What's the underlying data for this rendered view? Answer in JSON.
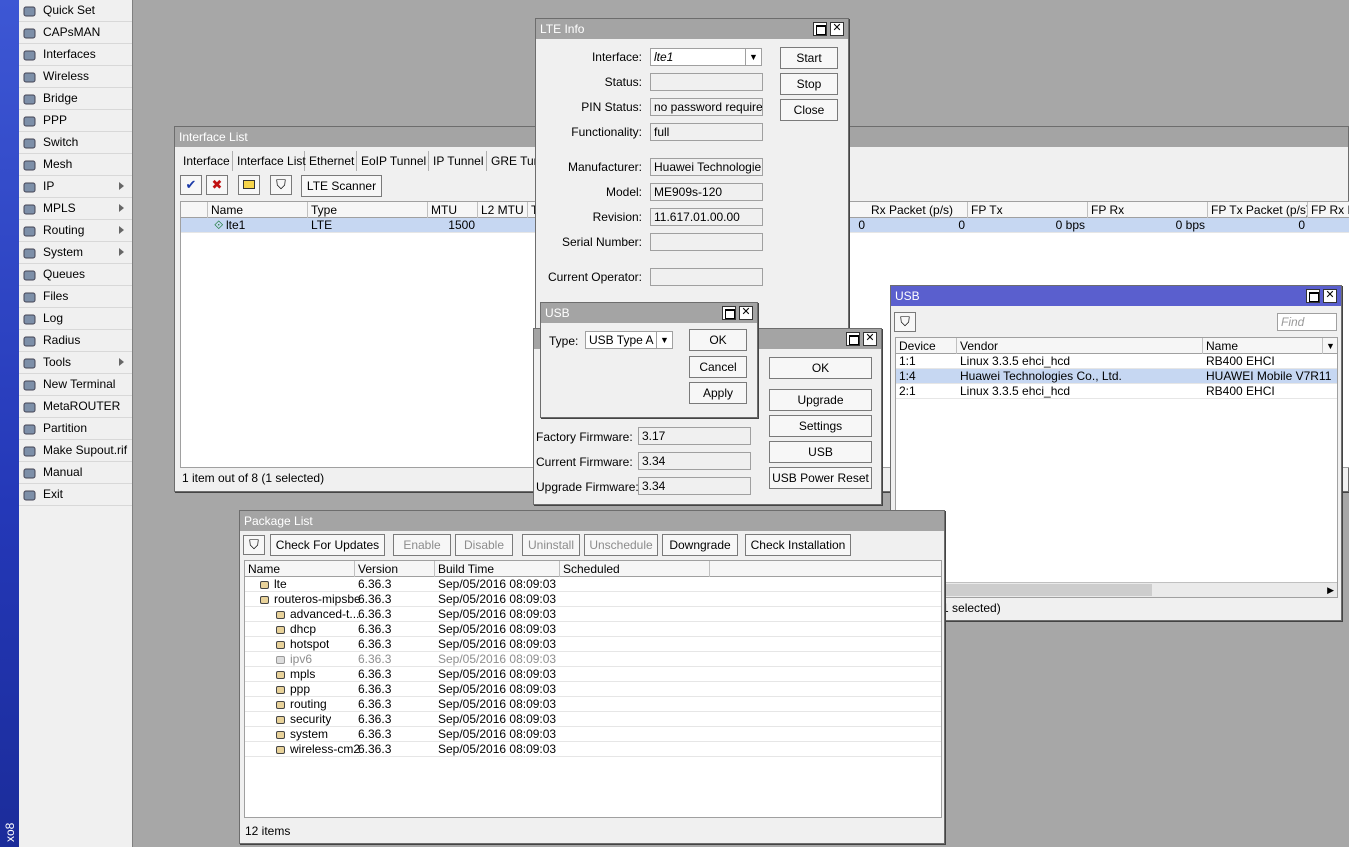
{
  "app": {
    "sidebar_label": "xo8"
  },
  "menu": [
    {
      "label": "Quick Set",
      "icon": "quick-set-icon",
      "submenu": false
    },
    {
      "label": "CAPsMAN",
      "icon": "capsman-icon",
      "submenu": false
    },
    {
      "label": "Interfaces",
      "icon": "interfaces-icon",
      "submenu": false
    },
    {
      "label": "Wireless",
      "icon": "wireless-icon",
      "submenu": false
    },
    {
      "label": "Bridge",
      "icon": "bridge-icon",
      "submenu": false
    },
    {
      "label": "PPP",
      "icon": "ppp-icon",
      "submenu": false
    },
    {
      "label": "Switch",
      "icon": "switch-icon",
      "submenu": false
    },
    {
      "label": "Mesh",
      "icon": "mesh-icon",
      "submenu": false
    },
    {
      "label": "IP",
      "icon": "ip-icon",
      "submenu": true
    },
    {
      "label": "MPLS",
      "icon": "mpls-icon",
      "submenu": true
    },
    {
      "label": "Routing",
      "icon": "routing-icon",
      "submenu": true
    },
    {
      "label": "System",
      "icon": "system-icon",
      "submenu": true
    },
    {
      "label": "Queues",
      "icon": "queues-icon",
      "submenu": false
    },
    {
      "label": "Files",
      "icon": "files-icon",
      "submenu": false
    },
    {
      "label": "Log",
      "icon": "log-icon",
      "submenu": false
    },
    {
      "label": "Radius",
      "icon": "radius-icon",
      "submenu": false
    },
    {
      "label": "Tools",
      "icon": "tools-icon",
      "submenu": true
    },
    {
      "label": "New Terminal",
      "icon": "terminal-icon",
      "submenu": false
    },
    {
      "label": "MetaROUTER",
      "icon": "metarouter-icon",
      "submenu": false
    },
    {
      "label": "Partition",
      "icon": "partition-icon",
      "submenu": false
    },
    {
      "label": "Make Supout.rif",
      "icon": "supout-icon",
      "submenu": false
    },
    {
      "label": "Manual",
      "icon": "manual-icon",
      "submenu": false
    },
    {
      "label": "Exit",
      "icon": "exit-icon",
      "submenu": false
    }
  ],
  "interface_list": {
    "title": "Interface List",
    "tabs": [
      "Interface",
      "Interface List",
      "Ethernet",
      "EoIP Tunnel",
      "IP Tunnel",
      "GRE Tun"
    ],
    "lte_scanner": "LTE Scanner",
    "columns": [
      "Name",
      "Type",
      "MTU",
      "L2 MTU",
      "T",
      "Rx Packet (p/s)",
      "FP Tx",
      "FP Rx",
      "FP Tx Packet (p/s)",
      "FP Rx P"
    ],
    "row": {
      "name": "lte1",
      "type": "LTE",
      "mtu": "1500",
      "tx_packet": "0",
      "rx_packet": "0",
      "fp_tx": "0 bps",
      "fp_rx": "0 bps",
      "fp_tx_packet": "0"
    },
    "status": "1 item out of 8 (1 selected)"
  },
  "lte_info": {
    "title": "LTE Info",
    "fields": {
      "interface_label": "Interface:",
      "interface_value": "lte1",
      "status_label": "Status:",
      "status_value": "",
      "pin_label": "PIN Status:",
      "pin_value": "no password required",
      "func_label": "Functionality:",
      "func_value": "full",
      "manuf_label": "Manufacturer:",
      "manuf_value": "Huawei Technologie...",
      "model_label": "Model:",
      "model_value": "ME909s-120",
      "rev_label": "Revision:",
      "rev_value": "11.617.01.00.00",
      "serial_label": "Serial Number:",
      "serial_value": "",
      "operator_label": "Current Operator:",
      "operator_value": ""
    },
    "buttons": {
      "start": "Start",
      "stop": "Stop",
      "close": "Close"
    }
  },
  "firmware": {
    "factory_label": "Factory Firmware:",
    "factory_value": "3.17",
    "current_label": "Current Firmware:",
    "current_value": "3.34",
    "upgrade_label": "Upgrade Firmware:",
    "upgrade_value": "3.34",
    "buttons": {
      "ok": "OK",
      "upgrade": "Upgrade",
      "settings": "Settings",
      "usb": "USB",
      "usb_power_reset": "USB Power Reset"
    }
  },
  "usb_dialog": {
    "title": "USB",
    "type_label": "Type:",
    "type_value": "USB Type A",
    "buttons": {
      "ok": "OK",
      "cancel": "Cancel",
      "apply": "Apply"
    }
  },
  "usb_window": {
    "title": "USB",
    "find_placeholder": "Find",
    "columns": [
      "Device",
      "Vendor",
      "Name"
    ],
    "rows": [
      {
        "device": "1:1",
        "vendor": "Linux 3.3.5 ehci_hcd",
        "name": "RB400 EHCI",
        "selected": false
      },
      {
        "device": "1:4",
        "vendor": "Huawei Technologies Co., Ltd.",
        "name": "HUAWEI Mobile V7R11",
        "selected": true
      },
      {
        "device": "2:1",
        "vendor": "Linux 3.3.5 ehci_hcd",
        "name": "RB400 EHCI",
        "selected": false
      }
    ],
    "status": "3 items (1 selected)"
  },
  "package_list": {
    "title": "Package List",
    "buttons": {
      "check_updates": "Check For Updates",
      "enable": "Enable",
      "disable": "Disable",
      "uninstall": "Uninstall",
      "unschedule": "Unschedule",
      "downgrade": "Downgrade",
      "check_installation": "Check Installation"
    },
    "columns": [
      "Name",
      "Version",
      "Build Time",
      "Scheduled"
    ],
    "rows": [
      {
        "name": "lte",
        "version": "6.36.3",
        "build": "Sep/05/2016 08:09:03",
        "indent": 0,
        "disabled": false
      },
      {
        "name": "routeros-mipsbe",
        "version": "6.36.3",
        "build": "Sep/05/2016 08:09:03",
        "indent": 0,
        "disabled": false
      },
      {
        "name": "advanced-t...",
        "version": "6.36.3",
        "build": "Sep/05/2016 08:09:03",
        "indent": 1,
        "disabled": false
      },
      {
        "name": "dhcp",
        "version": "6.36.3",
        "build": "Sep/05/2016 08:09:03",
        "indent": 1,
        "disabled": false
      },
      {
        "name": "hotspot",
        "version": "6.36.3",
        "build": "Sep/05/2016 08:09:03",
        "indent": 1,
        "disabled": false
      },
      {
        "name": "ipv6",
        "version": "6.36.3",
        "build": "Sep/05/2016 08:09:03",
        "indent": 1,
        "disabled": true
      },
      {
        "name": "mpls",
        "version": "6.36.3",
        "build": "Sep/05/2016 08:09:03",
        "indent": 1,
        "disabled": false
      },
      {
        "name": "ppp",
        "version": "6.36.3",
        "build": "Sep/05/2016 08:09:03",
        "indent": 1,
        "disabled": false
      },
      {
        "name": "routing",
        "version": "6.36.3",
        "build": "Sep/05/2016 08:09:03",
        "indent": 1,
        "disabled": false
      },
      {
        "name": "security",
        "version": "6.36.3",
        "build": "Sep/05/2016 08:09:03",
        "indent": 1,
        "disabled": false
      },
      {
        "name": "system",
        "version": "6.36.3",
        "build": "Sep/05/2016 08:09:03",
        "indent": 1,
        "disabled": false
      },
      {
        "name": "wireless-cm2",
        "version": "6.36.3",
        "build": "Sep/05/2016 08:09:03",
        "indent": 1,
        "disabled": false
      }
    ],
    "status": "12 items"
  },
  "colors": {
    "active_title": "#5a5fce",
    "inactive_title": "#a4a4a4",
    "selection": "#c6d7f2",
    "desktop": "#a7a7a7"
  }
}
